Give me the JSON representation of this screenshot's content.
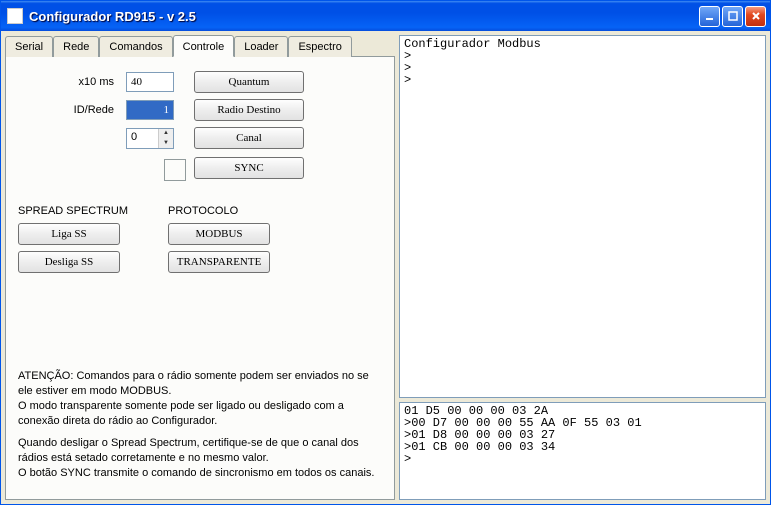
{
  "window": {
    "title": "Configurador RD915 - v 2.5"
  },
  "tabs": [
    "Serial",
    "Rede",
    "Comandos",
    "Controle",
    "Loader",
    "Espectro"
  ],
  "active_tab": "Controle",
  "controle": {
    "x10ms_label": "x10 ms",
    "x10ms_value": "40",
    "id_rede_label": "ID/Rede",
    "id_rede_value": "1",
    "canal_value": "0",
    "buttons": {
      "quantum": "Quantum",
      "radio_destino": "Radio Destino",
      "canal": "Canal",
      "sync": "SYNC"
    },
    "spread_section": "SPREAD SPECTRUM",
    "liga_ss": "Liga SS",
    "desliga_ss": "Desliga SS",
    "protocolo_section": "PROTOCOLO",
    "modbus": "MODBUS",
    "transparente": "TRANSPARENTE",
    "info1": "ATENÇÃO: Comandos para o rádio somente podem ser enviados no se ele estiver em modo MODBUS.\nO modo transparente somente pode ser ligado ou desligado com a conexão direta do rádio ao Configurador.",
    "info2": "Quando desligar o Spread Spectrum, certifique-se de que o canal dos rádios está setado corretamente e no mesmo valor.\nO botão SYNC transmite o comando de sincronismo em todos os canais."
  },
  "console_top": "Configurador Modbus\n>\n>\n>",
  "console_bottom": "01 D5 00 00 00 03 2A\n>00 D7 00 00 00 55 AA 0F 55 03 01\n>01 D8 00 00 00 03 27\n>01 CB 00 00 00 03 34\n>"
}
